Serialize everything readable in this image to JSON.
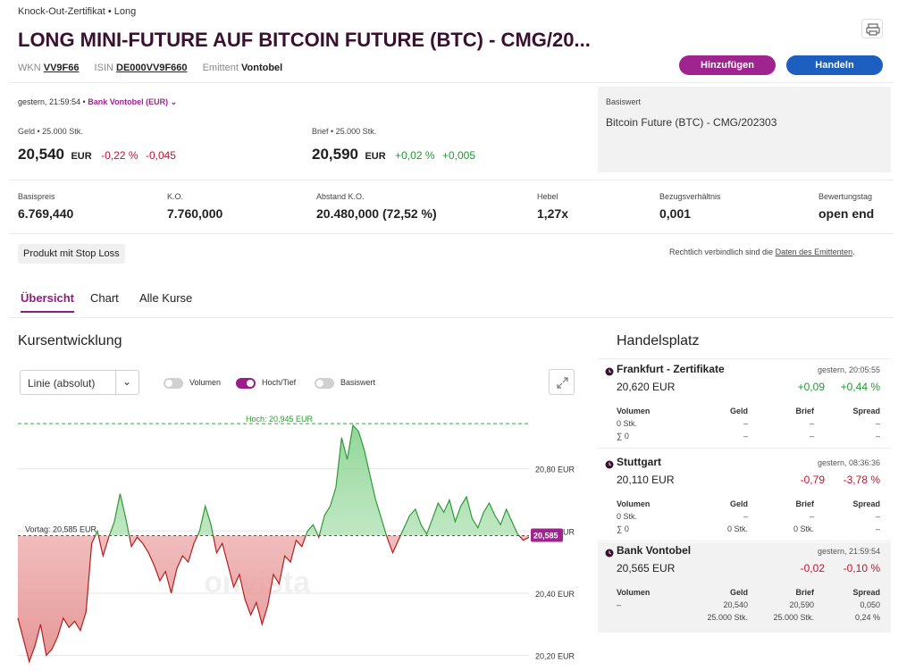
{
  "header": {
    "breadcrumb": "Knock-Out-Zertifikat • Long",
    "title": "LONG MINI-FUTURE AUF BITCOIN FUTURE (BTC) - CMG/20...",
    "wkn_label": "WKN",
    "wkn": "VV9F66",
    "isin_label": "ISIN",
    "isin": "DE000VV9F660",
    "emittent_label": "Emittent",
    "emittent": "Vontobel",
    "add_button": "Hinzufügen",
    "trade_button": "Handeln",
    "print_icon": "printer-icon"
  },
  "quote": {
    "timestamp": "gestern, 21:59:54 •",
    "exchange": "Bank Vontobel (EUR)",
    "bid_label": "Geld • 25.000 Stk.",
    "bid_value": "20,540",
    "bid_currency": "EUR",
    "bid_pct": "-0,22 %",
    "bid_abs": "-0,045",
    "ask_label": "Brief • 25.000 Stk.",
    "ask_value": "20,590",
    "ask_currency": "EUR",
    "ask_pct": "+0,02 %",
    "ask_abs": "+0,005"
  },
  "underlying": {
    "label": "Basiswert",
    "value": "Bitcoin Future (BTC) - CMG/202303"
  },
  "keyfigures": [
    {
      "label": "Basispreis",
      "value": "6.769,440"
    },
    {
      "label": "K.O.",
      "value": "7.760,000"
    },
    {
      "label": "Abstand K.O.",
      "value": "20.480,000 (72,52 %)"
    },
    {
      "label": "Hebel",
      "value": "1,27x"
    },
    {
      "label": "Bezugsverhältnis",
      "value": "0,001"
    },
    {
      "label": "Bewertungstag",
      "value": "open end"
    }
  ],
  "stoploss_badge": "Produkt mit Stop Loss",
  "legal": {
    "text": "Rechtlich verbindlich sind die",
    "link": "Daten des Emittenten",
    "suffix": "."
  },
  "tabs": [
    "Übersicht",
    "Chart",
    "Alle Kurse"
  ],
  "chart_section": {
    "title": "Kursentwicklung",
    "select_value": "Linie (absolut)",
    "toggles": [
      {
        "label": "Volumen",
        "on": false
      },
      {
        "label": "Hoch/Tief",
        "on": true
      },
      {
        "label": "Basiswert",
        "on": false
      }
    ],
    "high_label": "Hoch: 20,945 EUR",
    "prev_label": "Vortag: 20,585 EUR",
    "current_badge": "20,585",
    "watermark": "onvista",
    "expand_icon": "expand-icon"
  },
  "chart_data": {
    "type": "area",
    "title": "Kursentwicklung",
    "xlabel": "",
    "ylabel": "",
    "ylim": [
      20.15,
      21.0
    ],
    "yticks": [
      "20,80 EUR",
      "20,60 EUR",
      "20,40 EUR",
      "20,20 EUR"
    ],
    "ytick_values": [
      20.8,
      20.6,
      20.4,
      20.2
    ],
    "high": 20.945,
    "previous_close": 20.585,
    "last": 20.585,
    "series": [
      {
        "values": [
          20.32,
          20.25,
          20.18,
          20.23,
          20.3,
          20.2,
          20.22,
          20.26,
          20.32,
          20.29,
          20.31,
          20.28,
          20.34,
          20.56,
          20.6,
          20.52,
          20.58,
          20.63,
          20.72,
          20.64,
          20.55,
          20.58,
          20.56,
          20.53,
          20.49,
          20.44,
          20.47,
          20.4,
          20.48,
          20.52,
          20.5,
          20.56,
          20.6,
          20.68,
          20.62,
          20.53,
          20.56,
          20.49,
          20.42,
          20.46,
          20.38,
          20.33,
          20.37,
          20.3,
          20.36,
          20.46,
          20.43,
          20.52,
          20.5,
          20.57,
          20.55,
          20.6,
          20.62,
          20.58,
          20.65,
          20.68,
          20.74,
          20.9,
          20.83,
          20.94,
          20.92,
          20.86,
          20.78,
          20.7,
          20.64,
          20.58,
          20.53,
          20.57,
          20.61,
          20.65,
          20.67,
          20.62,
          20.59,
          20.64,
          20.69,
          20.66,
          20.7,
          20.63,
          20.68,
          20.71,
          20.64,
          20.61,
          20.66,
          20.69,
          20.65,
          20.62,
          20.67,
          20.63,
          20.59,
          20.57,
          20.58
        ]
      }
    ]
  },
  "trading": {
    "title": "Handelsplatz",
    "venues": [
      {
        "name": "Frankfurt - Zertifikate",
        "time": "gestern, 20:05:55",
        "price": "20,620 EUR",
        "chg": "+0,09",
        "pct": "+0,44 %",
        "up": true,
        "headers": [
          "Volumen",
          "Geld",
          "Brief",
          "Spread"
        ],
        "rows": [
          [
            "0 Stk.",
            "–",
            "–",
            "–"
          ],
          [
            "∑ 0",
            "–",
            "–",
            "–"
          ]
        ]
      },
      {
        "name": "Stuttgart",
        "time": "gestern, 08:36:36",
        "price": "20,110 EUR",
        "chg": "-0,79",
        "pct": "-3,78 %",
        "up": false,
        "headers": [
          "Volumen",
          "Geld",
          "Brief",
          "Spread"
        ],
        "rows": [
          [
            "0 Stk.",
            "–",
            "–",
            "–"
          ],
          [
            "∑ 0",
            "0 Stk.",
            "0 Stk.",
            "–"
          ]
        ]
      },
      {
        "name": "Bank Vontobel",
        "time": "gestern, 21:59:54",
        "price": "20,565 EUR",
        "chg": "-0,02",
        "pct": "-0,10 %",
        "up": false,
        "headers": [
          "Volumen",
          "Geld",
          "Brief",
          "Spread"
        ],
        "rows": [
          [
            "–",
            "20,540",
            "20,590",
            "0,050"
          ],
          [
            "",
            "25.000 Stk.",
            "25.000 Stk.",
            "0,24 %"
          ]
        ]
      }
    ]
  }
}
